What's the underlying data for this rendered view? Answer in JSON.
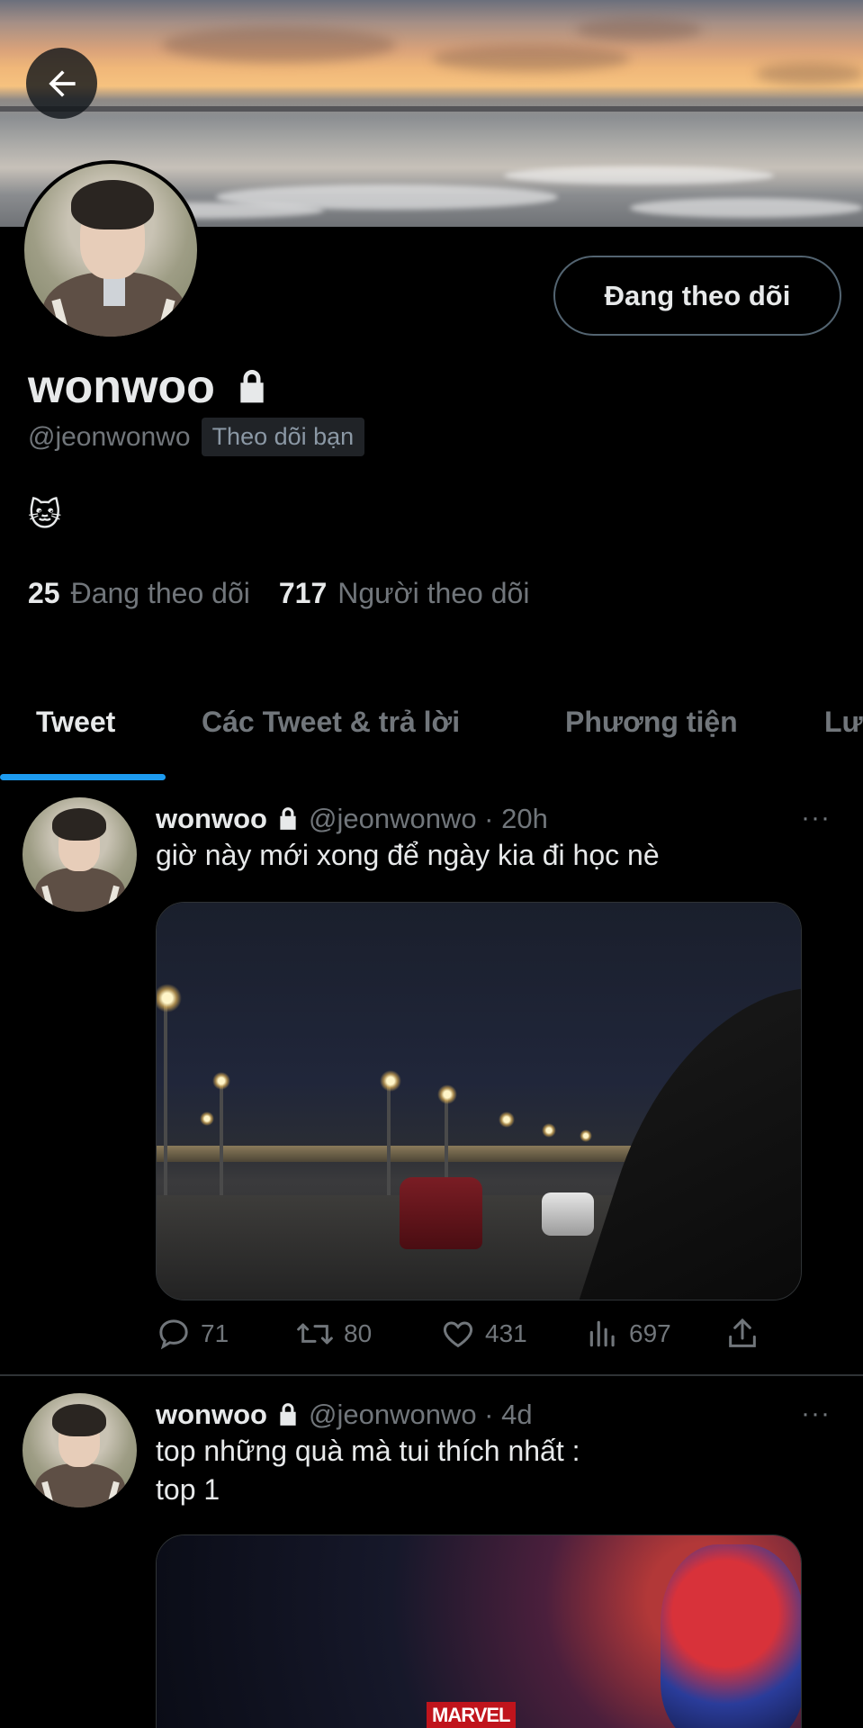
{
  "header": {
    "back_icon": "arrow-left-icon",
    "follow_button_label": "Đang theo dõi"
  },
  "profile": {
    "display_name": "wonwoo",
    "lock_icon": "lock-icon",
    "handle": "@jeonwonwo",
    "follows_you_badge": "Theo dõi bạn",
    "bio": "🐱",
    "following_count": "25",
    "following_label": "Đang theo dõi",
    "followers_count": "717",
    "followers_label": "Người theo dõi"
  },
  "tabs": [
    {
      "label": "Tweet",
      "active": true
    },
    {
      "label": "Các Tweet & trả lời",
      "active": false
    },
    {
      "label": "Phương tiện",
      "active": false
    },
    {
      "label": "Lư",
      "active": false
    }
  ],
  "tweets": [
    {
      "name": "wonwoo",
      "meta": "@jeonwonwo · 20h",
      "more": "···",
      "text": "giờ này mới xong để ngày kia đi học nè",
      "replies": "71",
      "retweets": "80",
      "likes": "431",
      "views": "697"
    },
    {
      "name": "wonwoo",
      "meta": "@jeonwonwo · 4d",
      "more": "···",
      "text_line1": "top những quà mà tui thích nhất :",
      "text_line2": "top 1",
      "media_logo": "MARVEL"
    }
  ],
  "colors": {
    "background": "#000000",
    "accent": "#1d9bf0",
    "text_primary": "#e7e9ea",
    "text_secondary": "#71767b"
  }
}
